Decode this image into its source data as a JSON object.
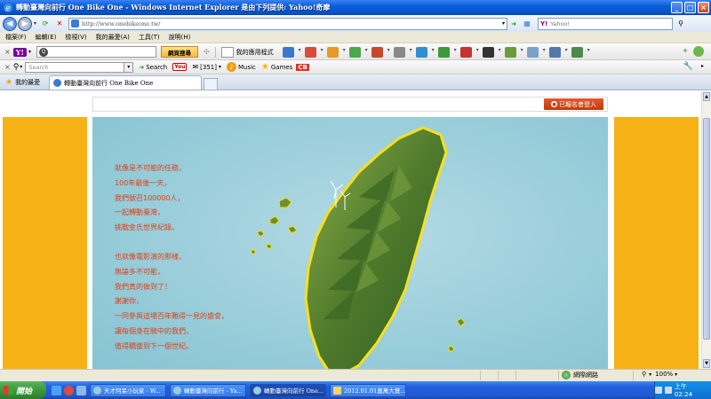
{
  "window": {
    "title": "轉動臺灣向前行 One Bike One - Windows Internet Explorer 是由下列提供: Yahoo!奇摩",
    "controls": [
      "_",
      "□",
      "×"
    ]
  },
  "address_bar": {
    "url": "http://www.onebikeone.tw/",
    "search_placeholder": "Yahoo!"
  },
  "menu": [
    "檔案(F)",
    "編輯(E)",
    "檢視(V)",
    "我的最愛(A)",
    "工具(T)",
    "說明(H)"
  ],
  "yahoo_toolbar": {
    "button_label": "網頁搜尋",
    "apps_label": "我的應用程式"
  },
  "toolbar2": {
    "search_placeholder": "Search",
    "search_label": "Search",
    "badge_count": "[351]",
    "music_label": "Music",
    "games_label": "Games",
    "cb_label": "CB"
  },
  "tabs": {
    "favorites_label": "我的最愛",
    "active_tab": "轉動臺灣向前行 One Bike One"
  },
  "page": {
    "login_button": "已報名者登入",
    "poem": [
      "就像是不可能的任務，",
      "100年最後一天，",
      "我們號召100000人，",
      "一起轉動臺灣，",
      "挑戰金氏世界紀錄。",
      "",
      "也就像電影演的那樣，",
      "無論多不可能，",
      "我們真的做到了！",
      "謝謝你，",
      "一同參與這場百年難得一見的盛會，",
      "讓每個身在騎中的我們，",
      "值得驕傲到下一個世紀。"
    ],
    "colors": {
      "side_panel": "#f6b117",
      "poem_text": "#e0401a",
      "login_button": "#c23a10"
    }
  },
  "status_bar": {
    "zone": "網際網路",
    "zoom": "100%"
  },
  "taskbar": {
    "start_label": "開始",
    "tasks": [
      "天才阿呆小玩家 - W...",
      "轉動臺灣向前行 - Ya...",
      "轉動臺灣向前行 One...",
      "2012.01.01奧萬大賞..."
    ],
    "clock": "上午 02:24"
  }
}
